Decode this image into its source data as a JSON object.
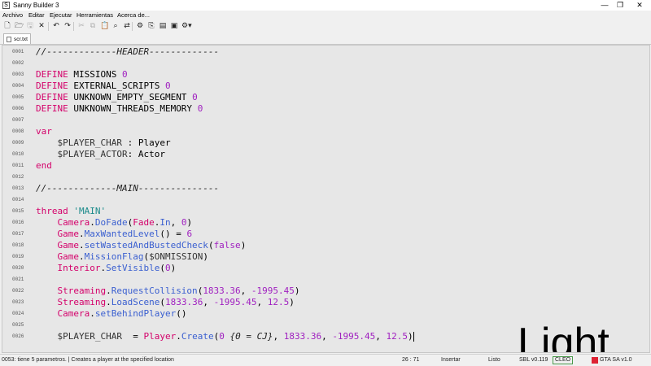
{
  "window": {
    "title": "Sanny Builder 3",
    "minimize": "—",
    "maximize": "❐",
    "close": "✕"
  },
  "menu": [
    "Archivo",
    "Editar",
    "Ejecutar",
    "Herramientas",
    "Acerca de..."
  ],
  "toolbar": [
    {
      "name": "new-file-icon",
      "glyph": "🗋",
      "enabled": true
    },
    {
      "name": "open-folder-icon",
      "glyph": "🗁",
      "enabled": true
    },
    {
      "name": "save-icon",
      "glyph": "🖫",
      "enabled": false
    },
    {
      "name": "close-icon",
      "glyph": "✕",
      "enabled": true
    },
    {
      "name": "undo-icon",
      "glyph": "↶",
      "enabled": true
    },
    {
      "name": "redo-icon",
      "glyph": "↷",
      "enabled": true
    },
    {
      "name": "cut-icon",
      "glyph": "✂",
      "enabled": false
    },
    {
      "name": "copy-icon",
      "glyph": "⧉",
      "enabled": false
    },
    {
      "name": "paste-icon",
      "glyph": "📋",
      "enabled": false
    },
    {
      "name": "find-icon",
      "glyph": "⌕",
      "enabled": true
    },
    {
      "name": "replace-icon",
      "glyph": "⇄",
      "enabled": true
    },
    {
      "name": "compile-icon",
      "glyph": "⚙",
      "enabled": true
    },
    {
      "name": "decompile-icon",
      "glyph": "⎘",
      "enabled": true
    },
    {
      "name": "opcode-search-icon",
      "glyph": "▤",
      "enabled": true
    },
    {
      "name": "game-icon",
      "glyph": "▣",
      "enabled": true
    },
    {
      "name": "settings-icon",
      "glyph": "⚙▾",
      "enabled": true
    }
  ],
  "tab": {
    "label": "scr.txt"
  },
  "editor": {
    "lines": [
      {
        "n": "0001",
        "tokens": [
          {
            "t": "//-------------HEADER-------------",
            "c": "comment"
          }
        ]
      },
      {
        "n": "0002",
        "tokens": []
      },
      {
        "n": "0003",
        "tokens": [
          {
            "t": "DEFINE ",
            "c": "keyword"
          },
          {
            "t": "MISSIONS ",
            "c": "plain"
          },
          {
            "t": "0",
            "c": "number"
          }
        ]
      },
      {
        "n": "0004",
        "tokens": [
          {
            "t": "DEFINE ",
            "c": "keyword"
          },
          {
            "t": "EXTERNAL_SCRIPTS ",
            "c": "plain"
          },
          {
            "t": "0",
            "c": "number"
          }
        ]
      },
      {
        "n": "0005",
        "tokens": [
          {
            "t": "DEFINE ",
            "c": "keyword"
          },
          {
            "t": "UNKNOWN_EMPTY_SEGMENT ",
            "c": "plain"
          },
          {
            "t": "0",
            "c": "number"
          }
        ]
      },
      {
        "n": "0006",
        "tokens": [
          {
            "t": "DEFINE ",
            "c": "keyword"
          },
          {
            "t": "UNKNOWN_THREADS_MEMORY ",
            "c": "plain"
          },
          {
            "t": "0",
            "c": "number"
          }
        ]
      },
      {
        "n": "0007",
        "tokens": []
      },
      {
        "n": "0008",
        "tokens": [
          {
            "t": "var",
            "c": "keyword"
          }
        ]
      },
      {
        "n": "0009",
        "tokens": [
          {
            "t": "    $PLAYER_CHAR ",
            "c": "var"
          },
          {
            "t": ": Player",
            "c": "plain"
          }
        ]
      },
      {
        "n": "0010",
        "tokens": [
          {
            "t": "    $PLAYER_ACTOR",
            "c": "var"
          },
          {
            "t": ": Actor",
            "c": "plain"
          }
        ]
      },
      {
        "n": "0011",
        "tokens": [
          {
            "t": "end",
            "c": "keyword"
          }
        ]
      },
      {
        "n": "0012",
        "tokens": []
      },
      {
        "n": "0013",
        "tokens": [
          {
            "t": "//-------------MAIN---------------",
            "c": "comment"
          }
        ]
      },
      {
        "n": "0014",
        "tokens": []
      },
      {
        "n": "0015",
        "tokens": [
          {
            "t": "thread ",
            "c": "keyword"
          },
          {
            "t": "'MAIN'",
            "c": "string"
          }
        ]
      },
      {
        "n": "0016",
        "tokens": [
          {
            "t": "    Camera",
            "c": "class"
          },
          {
            "t": ".",
            "c": "plain"
          },
          {
            "t": "DoFade",
            "c": "method"
          },
          {
            "t": "(",
            "c": "plain"
          },
          {
            "t": "Fade",
            "c": "class"
          },
          {
            "t": ".",
            "c": "plain"
          },
          {
            "t": "In",
            "c": "method"
          },
          {
            "t": ", ",
            "c": "plain"
          },
          {
            "t": "0",
            "c": "number"
          },
          {
            "t": ")",
            "c": "plain"
          }
        ]
      },
      {
        "n": "0017",
        "tokens": [
          {
            "t": "    Game",
            "c": "class"
          },
          {
            "t": ".",
            "c": "plain"
          },
          {
            "t": "MaxWantedLevel",
            "c": "method"
          },
          {
            "t": "() = ",
            "c": "plain"
          },
          {
            "t": "6",
            "c": "number"
          }
        ]
      },
      {
        "n": "0018",
        "tokens": [
          {
            "t": "    Game",
            "c": "class"
          },
          {
            "t": ".",
            "c": "plain"
          },
          {
            "t": "setWastedAndBustedCheck",
            "c": "method"
          },
          {
            "t": "(",
            "c": "plain"
          },
          {
            "t": "false",
            "c": "number"
          },
          {
            "t": ")",
            "c": "plain"
          }
        ]
      },
      {
        "n": "0019",
        "tokens": [
          {
            "t": "    Game",
            "c": "class"
          },
          {
            "t": ".",
            "c": "plain"
          },
          {
            "t": "MissionFlag",
            "c": "method"
          },
          {
            "t": "(",
            "c": "plain"
          },
          {
            "t": "$ONMISSION",
            "c": "var"
          },
          {
            "t": ")",
            "c": "plain"
          }
        ]
      },
      {
        "n": "0020",
        "tokens": [
          {
            "t": "    Interior",
            "c": "class"
          },
          {
            "t": ".",
            "c": "plain"
          },
          {
            "t": "SetVisible",
            "c": "method"
          },
          {
            "t": "(",
            "c": "plain"
          },
          {
            "t": "0",
            "c": "number"
          },
          {
            "t": ")",
            "c": "plain"
          }
        ]
      },
      {
        "n": "0021",
        "tokens": []
      },
      {
        "n": "0022",
        "tokens": [
          {
            "t": "    Streaming",
            "c": "class"
          },
          {
            "t": ".",
            "c": "plain"
          },
          {
            "t": "RequestCollision",
            "c": "method"
          },
          {
            "t": "(",
            "c": "plain"
          },
          {
            "t": "1833.36",
            "c": "number"
          },
          {
            "t": ", ",
            "c": "plain"
          },
          {
            "t": "-1995.45",
            "c": "number"
          },
          {
            "t": ")",
            "c": "plain"
          }
        ]
      },
      {
        "n": "0023",
        "tokens": [
          {
            "t": "    Streaming",
            "c": "class"
          },
          {
            "t": ".",
            "c": "plain"
          },
          {
            "t": "LoadScene",
            "c": "method"
          },
          {
            "t": "(",
            "c": "plain"
          },
          {
            "t": "1833.36",
            "c": "number"
          },
          {
            "t": ", ",
            "c": "plain"
          },
          {
            "t": "-1995.45",
            "c": "number"
          },
          {
            "t": ", ",
            "c": "plain"
          },
          {
            "t": "12.5",
            "c": "number"
          },
          {
            "t": ")",
            "c": "plain"
          }
        ]
      },
      {
        "n": "0024",
        "tokens": [
          {
            "t": "    Camera",
            "c": "class"
          },
          {
            "t": ".",
            "c": "plain"
          },
          {
            "t": "setBehindPlayer",
            "c": "method"
          },
          {
            "t": "()",
            "c": "plain"
          }
        ]
      },
      {
        "n": "0025",
        "tokens": []
      },
      {
        "n": "0026",
        "tokens": [
          {
            "t": "    $PLAYER_CHAR ",
            "c": "var"
          },
          {
            "t": " = ",
            "c": "plain"
          },
          {
            "t": "Player",
            "c": "class"
          },
          {
            "t": ".",
            "c": "plain"
          },
          {
            "t": "Create",
            "c": "method"
          },
          {
            "t": "(",
            "c": "plain"
          },
          {
            "t": "0",
            "c": "number"
          },
          {
            "t": " {0 = CJ}",
            "c": "comment"
          },
          {
            "t": ", ",
            "c": "plain"
          },
          {
            "t": "1833.36",
            "c": "number"
          },
          {
            "t": ", ",
            "c": "plain"
          },
          {
            "t": "-1995.45",
            "c": "number"
          },
          {
            "t": ", ",
            "c": "plain"
          },
          {
            "t": "12.5",
            "c": "number"
          },
          {
            "t": ")",
            "c": "plain"
          }
        ],
        "caret": true
      }
    ]
  },
  "watermark": "Light",
  "status": {
    "hint": "0053: tiene 5 parametros. | Creates a player at the specified location",
    "position": "26 : 71",
    "mode": "Insertar",
    "state": "Listo",
    "version": "SBL v0.119",
    "cleo": "CLEO",
    "game": "GTA SA v1.0"
  },
  "colors": {
    "keyword": "#d4006a",
    "number": "#a020c0",
    "method": "#3a5fd0",
    "string": "#1a8a8a",
    "editor_bg": "#e7e7e7"
  }
}
